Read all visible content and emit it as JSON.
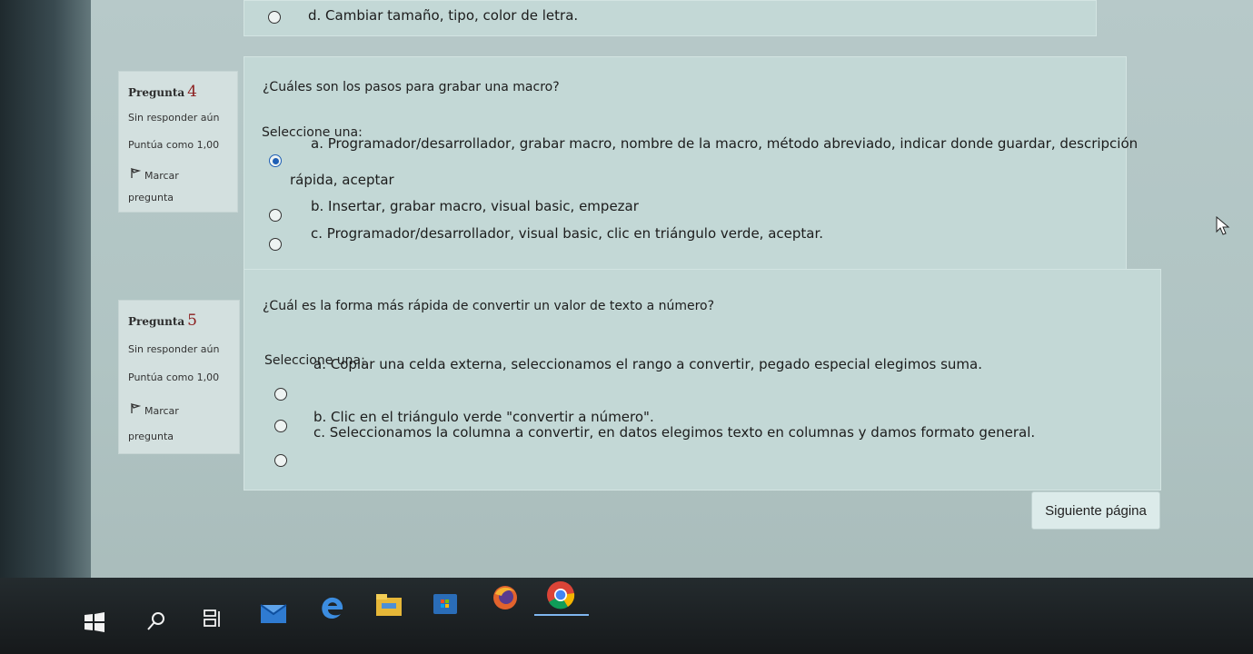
{
  "top_option": {
    "label": "d. Cambiar tamaño, tipo, color de letra."
  },
  "question4": {
    "number_prefix": "Pregunta",
    "number": "4",
    "status": "Sin responder aún",
    "score": "Puntúa como 1,00",
    "flag_label_1": "Marcar",
    "flag_label_2": "pregunta",
    "text": "¿Cuáles son los pasos para grabar una macro?",
    "select_prompt": "Seleccione una:",
    "options": [
      {
        "line1": "a. Programador/desarrollador, grabar macro, nombre de la macro, método abreviado, indicar donde guardar, descripción",
        "line2": "rápida, aceptar",
        "checked": true
      },
      {
        "line1": "b. Insertar, grabar macro, visual basic, empezar",
        "checked": false
      },
      {
        "line1": "c. Programador/desarrollador, visual basic, clic en triángulo verde, aceptar.",
        "checked": false
      }
    ]
  },
  "question5": {
    "number_prefix": "Pregunta",
    "number": "5",
    "status": "Sin responder aún",
    "score": "Puntúa como 1,00",
    "flag_label_1": "Marcar",
    "flag_label_2": "pregunta",
    "text": "¿Cuál es la forma más rápida de convertir un valor de texto a número?",
    "select_prompt": "Seleccione una:",
    "options": [
      {
        "line1": "a. Copiar una celda externa, seleccionamos el rango a convertir, pegado especial elegimos suma.",
        "checked": false
      },
      {
        "line1": "b. Clic en el triángulo verde \"convertir a número\".",
        "checked": false
      },
      {
        "line1": "c. Seleccionamos la columna a convertir, en datos elegimos texto en columnas y damos formato general.",
        "checked": false
      }
    ]
  },
  "next_button": {
    "label": "Siguiente página"
  },
  "taskbar": {
    "icons": [
      "windows-start-icon",
      "search-icon",
      "task-view-icon",
      "mail-icon",
      "edge-icon",
      "file-explorer-icon",
      "store-icon",
      "firefox-icon",
      "chrome-icon"
    ]
  },
  "colors": {
    "accent": "#1f5fb5",
    "question_number": "#8b1d1d",
    "card": "#c3d8d6"
  }
}
